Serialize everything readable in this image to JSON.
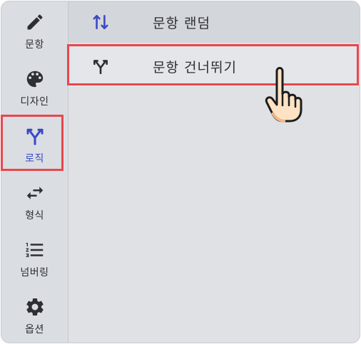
{
  "sidebar": {
    "items": [
      {
        "label": "문항",
        "icon": "pencil-icon"
      },
      {
        "label": "디자인",
        "icon": "palette-icon"
      },
      {
        "label": "로직",
        "icon": "branch-icon",
        "active": true
      },
      {
        "label": "형식",
        "icon": "swap-icon"
      },
      {
        "label": "넘버링",
        "icon": "numbered-list-icon"
      },
      {
        "label": "옵션",
        "icon": "gear-icon"
      }
    ]
  },
  "menu": {
    "items": [
      {
        "label": "문항 랜덤",
        "icon": "shuffle-arrows-icon"
      },
      {
        "label": "문항 건너뛰기",
        "icon": "branch-icon",
        "highlighted": true
      }
    ]
  },
  "colors": {
    "accent": "#3a49c4",
    "highlight": "#e8474d"
  }
}
